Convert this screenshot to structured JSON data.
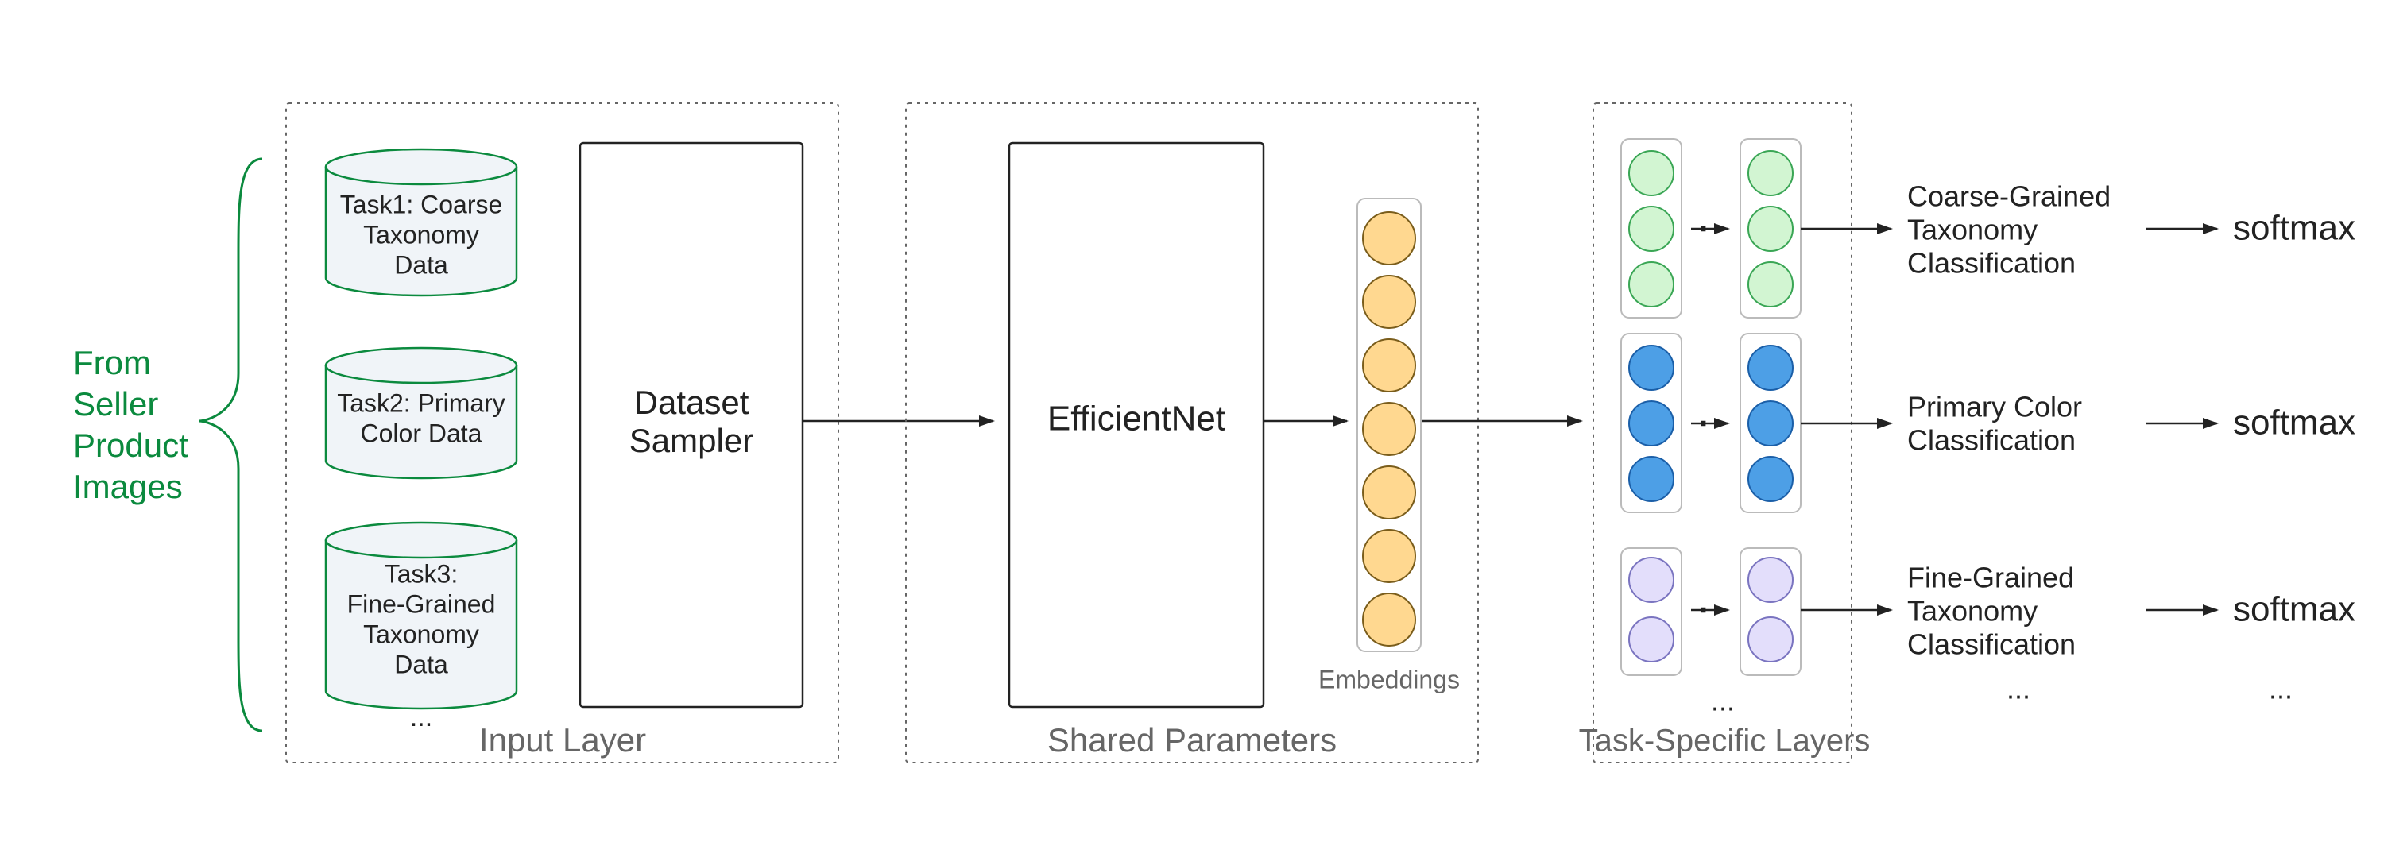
{
  "leftLabel": {
    "line1": "From",
    "line2": "Seller",
    "line3": "Product",
    "line4": "Images"
  },
  "panels": {
    "input": {
      "caption": "Input Layer"
    },
    "shared": {
      "caption": "Shared Parameters"
    },
    "taskspec": {
      "caption": "Task-Specific Layers"
    }
  },
  "db": {
    "task1": {
      "line1": "Task1: Coarse",
      "line2": "Taxonomy",
      "line3": "Data"
    },
    "task2": {
      "line1": "Task2: Primary",
      "line2": "Color Data"
    },
    "task3": {
      "line1": "Task3:",
      "line2": "Fine-Grained",
      "line3": "Taxonomy",
      "line4": "Data"
    },
    "dots": "..."
  },
  "samplerBox": {
    "line1": "Dataset",
    "line2": "Sampler"
  },
  "efficientnet": "EfficientNet",
  "embeddingsLabel": "Embeddings",
  "tasks": {
    "t1": {
      "line1": "Coarse-Grained",
      "line2": "Taxonomy",
      "line3": "Classification",
      "softmax": "softmax"
    },
    "t2": {
      "line1": "Primary Color",
      "line2": "Classification",
      "softmax": "softmax"
    },
    "t3": {
      "line1": "Fine-Grained",
      "line2": "Taxonomy",
      "line3": "Classification",
      "softmax": "softmax"
    },
    "dots": "..."
  },
  "ellipsis": ":",
  "colors": {
    "green": "#0b8a3e",
    "cylFill": "#f0f4f8",
    "cylStroke": "#0b8a3e",
    "embFill": "#ffd890",
    "embStroke": "#7a5d1b",
    "greenFill": "#d2f5d2",
    "greenStroke": "#3aa655",
    "blueFill": "#4d9fe6",
    "blueStroke": "#1b5fa8",
    "lilacFill": "#e3defb",
    "lilacStroke": "#7a74c0",
    "boxStroke": "#222",
    "dotted": "#666",
    "grayText": "#555"
  }
}
